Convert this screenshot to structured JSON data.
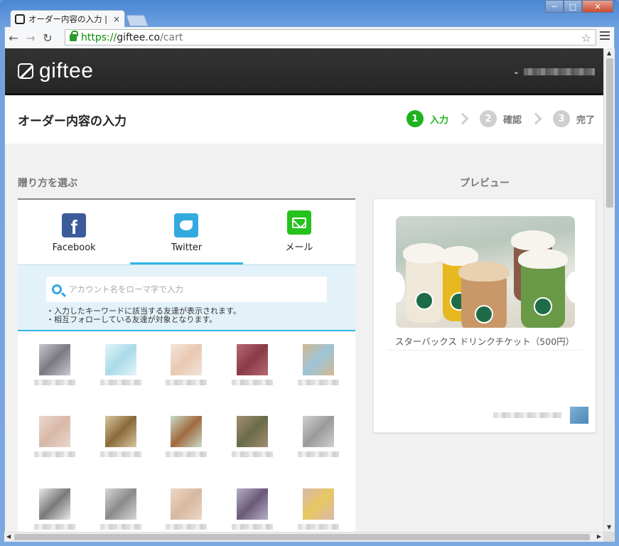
{
  "browser": {
    "tab_title": "オーダー内容の入力 | ソ",
    "tab_close": "×",
    "url_scheme": "https://",
    "url_host": "giftee.co",
    "url_path": "/cart",
    "window_buttons": {
      "minimize": "─",
      "maximize": "□",
      "close": "✕"
    }
  },
  "header": {
    "logo_text": "giftee",
    "user_menu_caret": "⌄"
  },
  "titlebar": {
    "title": "オーダー内容の入力",
    "steps": [
      {
        "num": "1",
        "label": "入力",
        "active": true
      },
      {
        "num": "2",
        "label": "確認",
        "active": false
      },
      {
        "num": "3",
        "label": "完了",
        "active": false
      }
    ]
  },
  "gift_method": {
    "section_label": "贈り方を選ぶ",
    "methods": [
      {
        "label": "Facebook",
        "icon": "facebook-icon",
        "color": "#3b5b9a"
      },
      {
        "label": "Twitter",
        "icon": "twitter-icon",
        "color": "#33a9e0",
        "selected": true
      },
      {
        "label": "メール",
        "icon": "mail-icon",
        "color": "#25c21b"
      }
    ],
    "search_placeholder": "アカウント名をローマ字で入力",
    "hints": [
      "・入力したキーワードに該当する友達が表示されます。",
      "・相互フォローしている友達が対象となります。"
    ]
  },
  "friends": [
    {
      "colors": [
        "#7a7a80",
        "#c8c8d0"
      ]
    },
    {
      "colors": [
        "#a9dbe8",
        "#e3f4f8"
      ]
    },
    {
      "colors": [
        "#e8c8b0",
        "#f4e4dc"
      ]
    },
    {
      "colors": [
        "#8a3a48",
        "#b86a70"
      ]
    },
    {
      "colors": [
        "#9cc4d8",
        "#d4b890"
      ]
    },
    {
      "colors": [
        "#d8b8a8",
        "#ead8cc"
      ]
    },
    {
      "colors": [
        "#8a6a3a",
        "#d8c8a0"
      ]
    },
    {
      "colors": [
        "#a06a40",
        "#c8dcc8"
      ]
    },
    {
      "colors": [
        "#6a6a4a",
        "#a09070"
      ]
    },
    {
      "colors": [
        "#9a9a9a",
        "#d0d0d0"
      ]
    },
    {
      "colors": [
        "#7a7a7a",
        "#e8e8e8"
      ]
    },
    {
      "colors": [
        "#8a8a8a",
        "#d8d8d8"
      ]
    },
    {
      "colors": [
        "#d8b8a0",
        "#ecd8c8"
      ]
    },
    {
      "colors": [
        "#6a5a78",
        "#b8b0c8"
      ]
    },
    {
      "colors": [
        "#e8c860",
        "#d8b8b0"
      ]
    }
  ],
  "preview": {
    "label": "プレビュー",
    "ticket_name": "スターバックス ドリンクチケット（500円）",
    "accent": "#1e6b48"
  }
}
